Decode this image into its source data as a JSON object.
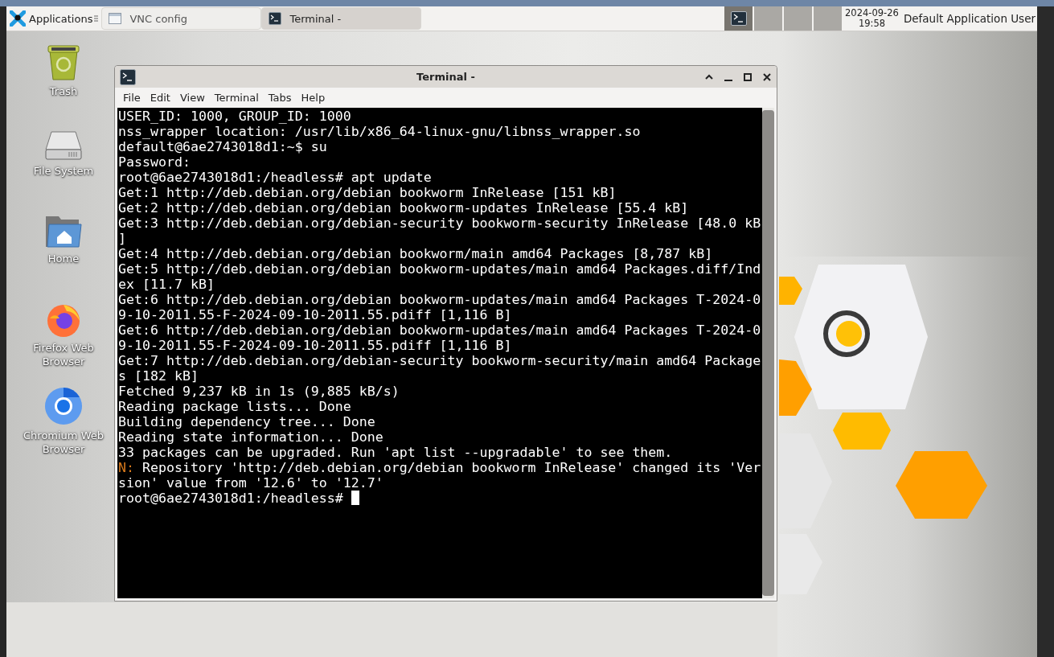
{
  "taskbar": {
    "apps_button": "Applications",
    "tasks": [
      {
        "label": "VNC config",
        "kind": "window",
        "selected": false
      },
      {
        "label": "Terminal -",
        "kind": "terminal",
        "selected": true
      }
    ],
    "workspaces": [
      {
        "selected": true
      },
      {
        "selected": false
      },
      {
        "selected": false
      },
      {
        "selected": false
      }
    ],
    "clock": {
      "date": "2024-09-26",
      "time": "19:58"
    },
    "user": "Default Application User"
  },
  "desktop_icons": [
    {
      "label": "Trash",
      "kind": "trash"
    },
    {
      "label": "File System",
      "kind": "drive"
    },
    {
      "label": "Home",
      "kind": "home"
    },
    {
      "label": "Firefox Web Browser",
      "kind": "firefox"
    },
    {
      "label": "Chromium Web Browser",
      "kind": "chromium"
    }
  ],
  "window": {
    "title": "Terminal -",
    "menu": [
      "File",
      "Edit",
      "View",
      "Terminal",
      "Tabs",
      "Help"
    ],
    "lines": [
      {
        "text": "USER_ID: 1000, GROUP_ID: 1000"
      },
      {
        "text": "nss_wrapper location: /usr/lib/x86_64-linux-gnu/libnss_wrapper.so"
      },
      {
        "text": "default@6ae2743018d1:~$ su"
      },
      {
        "text": "Password:"
      },
      {
        "text": "root@6ae2743018d1:/headless# apt update"
      },
      {
        "text": "Get:1 http://deb.debian.org/debian bookworm InRelease [151 kB]"
      },
      {
        "text": "Get:2 http://deb.debian.org/debian bookworm-updates InRelease [55.4 kB]"
      },
      {
        "text": "Get:3 http://deb.debian.org/debian-security bookworm-security InRelease [48.0 kB"
      },
      {
        "text": "]"
      },
      {
        "text": "Get:4 http://deb.debian.org/debian bookworm/main amd64 Packages [8,787 kB]"
      },
      {
        "text": "Get:5 http://deb.debian.org/debian bookworm-updates/main amd64 Packages.diff/Ind"
      },
      {
        "text": "ex [11.7 kB]"
      },
      {
        "text": "Get:6 http://deb.debian.org/debian bookworm-updates/main amd64 Packages T-2024-0"
      },
      {
        "text": "9-10-2011.55-F-2024-09-10-2011.55.pdiff [1,116 B]"
      },
      {
        "text": "Get:6 http://deb.debian.org/debian bookworm-updates/main amd64 Packages T-2024-0"
      },
      {
        "text": "9-10-2011.55-F-2024-09-10-2011.55.pdiff [1,116 B]"
      },
      {
        "text": "Get:7 http://deb.debian.org/debian-security bookworm-security/main amd64 Package"
      },
      {
        "text": "s [182 kB]"
      },
      {
        "text": "Fetched 9,237 kB in 1s (9,885 kB/s)"
      },
      {
        "text": "Reading package lists... Done"
      },
      {
        "text": "Building dependency tree... Done"
      },
      {
        "text": "Reading state information... Done"
      },
      {
        "text": "33 packages can be upgraded. Run 'apt list --upgradable' to see them."
      },
      {
        "label": "N:",
        "text": "Repository 'http://deb.debian.org/debian bookworm InRelease' changed its 'Ver"
      },
      {
        "text": "sion' value from '12.6' to '12.7'"
      },
      {
        "text": "root@6ae2743018d1:/headless#",
        "cursor": true
      }
    ]
  }
}
